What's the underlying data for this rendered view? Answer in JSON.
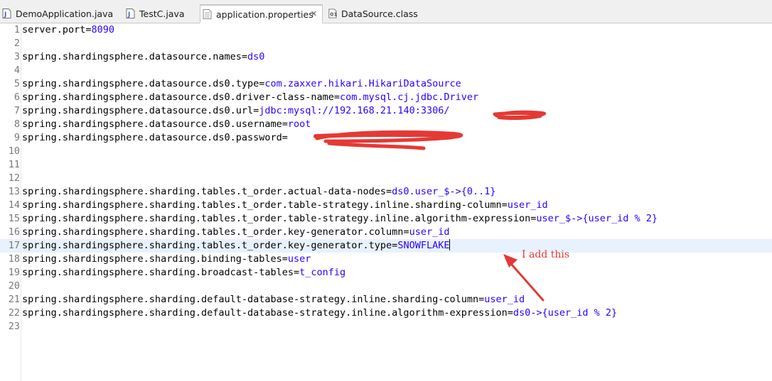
{
  "tabs": [
    {
      "label": "DemoApplication.java",
      "icon": "java-file-icon",
      "active": false
    },
    {
      "label": "TestC.java",
      "icon": "java-file-icon",
      "active": false
    },
    {
      "label": "application.properties",
      "icon": "properties-file-icon",
      "active": true,
      "close": "✕"
    },
    {
      "label": "DataSource.class",
      "icon": "class-file-icon",
      "active": false
    }
  ],
  "editor": {
    "current_line": 17,
    "lines": [
      {
        "n": "1",
        "key": "server.port=",
        "value": "8090"
      },
      {
        "n": "2",
        "key": "",
        "value": ""
      },
      {
        "n": "3",
        "key": "spring.shardingsphere.datasource.names=",
        "value": "ds0"
      },
      {
        "n": "4",
        "key": "",
        "value": ""
      },
      {
        "n": "5",
        "key": "spring.shardingsphere.datasource.ds0.type=",
        "value": "com.zaxxer.hikari.HikariDataSource"
      },
      {
        "n": "6",
        "key": "spring.shardingsphere.datasource.ds0.driver-class-name=",
        "value": "com.mysql.cj.jdbc.Driver"
      },
      {
        "n": "7",
        "key": "spring.shardingsphere.datasource.ds0.url=",
        "value": "jdbc:mysql://192.168.21.140:3306/"
      },
      {
        "n": "8",
        "key": "spring.shardingsphere.datasource.ds0.username=",
        "value": "root"
      },
      {
        "n": "9",
        "key": "spring.shardingsphere.datasource.ds0.password=",
        "value": ""
      },
      {
        "n": "10",
        "key": "",
        "value": ""
      },
      {
        "n": "11",
        "key": "",
        "value": ""
      },
      {
        "n": "12",
        "key": "",
        "value": ""
      },
      {
        "n": "13",
        "key": "spring.shardingsphere.sharding.tables.t_order.actual-data-nodes=",
        "value": "ds0.user_$->{0..1}"
      },
      {
        "n": "14",
        "key": "spring.shardingsphere.sharding.tables.t_order.table-strategy.inline.sharding-column=",
        "value": "user_id"
      },
      {
        "n": "15",
        "key": "spring.shardingsphere.sharding.tables.t_order.table-strategy.inline.algorithm-expression=",
        "value": "user_$->{user_id % 2}"
      },
      {
        "n": "16",
        "key": "spring.shardingsphere.sharding.tables.t_order.key-generator.column=",
        "value": "user_id"
      },
      {
        "n": "17",
        "key": "spring.shardingsphere.sharding.tables.t_order.key-generator.type=",
        "value": "SNOWFLAKE"
      },
      {
        "n": "18",
        "key": "spring.shardingsphere.sharding.binding-tables=",
        "value": "user"
      },
      {
        "n": "19",
        "key": "spring.shardingsphere.sharding.broadcast-tables=",
        "value": "t_config"
      },
      {
        "n": "20",
        "key": "",
        "value": ""
      },
      {
        "n": "21",
        "key": "spring.shardingsphere.sharding.default-database-strategy.inline.sharding-column=",
        "value": "user_id"
      },
      {
        "n": "22",
        "key": "spring.shardingsphere.sharding.default-database-strategy.inline.algorithm-expression=",
        "value": "ds0->{user_id % 2}"
      },
      {
        "n": "23",
        "key": "",
        "value": ""
      }
    ]
  },
  "annotation": {
    "text": "I add this",
    "color": "#e53935"
  },
  "colors": {
    "key": "#000000",
    "value": "#2a00ff",
    "line_number": "#787878",
    "current_line_bg": "#e8f2fe",
    "redaction": "#e53935"
  }
}
